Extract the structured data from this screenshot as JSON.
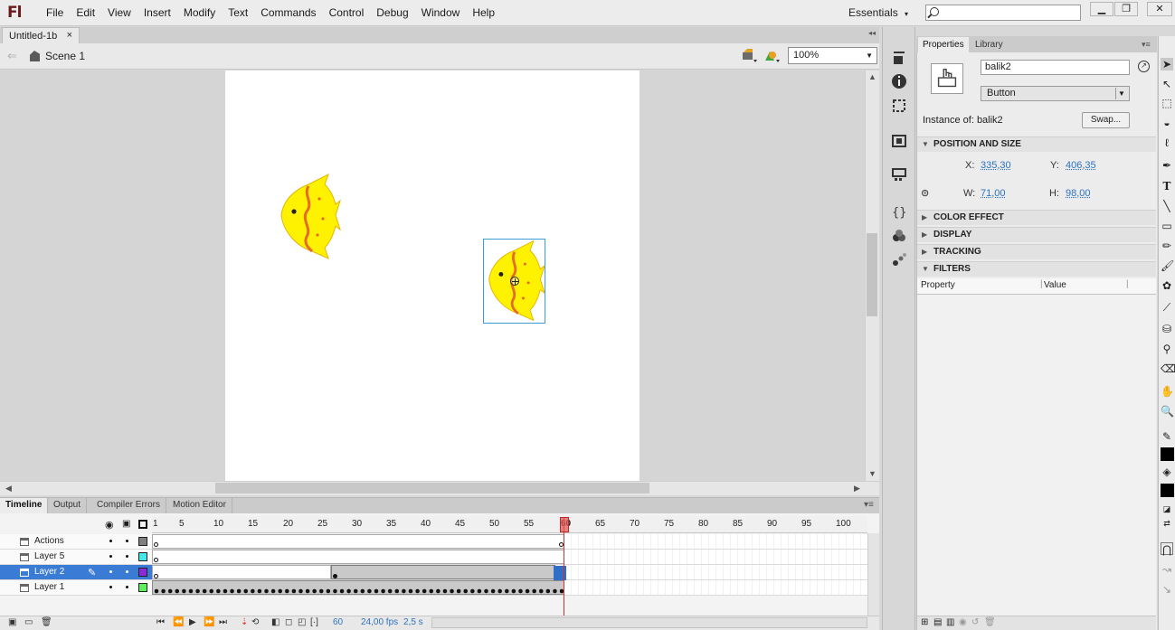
{
  "app": {
    "logo": "Fl",
    "menu": [
      "File",
      "Edit",
      "View",
      "Insert",
      "Modify",
      "Text",
      "Commands",
      "Control",
      "Debug",
      "Window",
      "Help"
    ],
    "workspace": "Essentials",
    "search_placeholder": ""
  },
  "document": {
    "tab_title": "Untitled-1b",
    "tab_close": "×",
    "scene": "Scene 1",
    "zoom": "100%"
  },
  "colors": {
    "selection": "#3f9bd6",
    "selected_layer": "#3a7bd5",
    "playhead": "#e02a2a",
    "fish_body": "#fff200",
    "fish_stripe": "#e8712a"
  },
  "timeline": {
    "tabs": [
      "Timeline",
      "Output",
      "Compiler Errors",
      "Motion Editor"
    ],
    "ruler": [
      "1",
      "5",
      "10",
      "15",
      "20",
      "25",
      "30",
      "35",
      "40",
      "45",
      "50",
      "55",
      "60",
      "65",
      "70",
      "75",
      "80",
      "85",
      "90",
      "95",
      "100"
    ],
    "layers": [
      {
        "name": "Actions",
        "color": "#7f7f7f",
        "selected": false
      },
      {
        "name": "Layer 5",
        "color": "#44e8e8",
        "selected": false
      },
      {
        "name": "Layer 2",
        "color": "#8a2bd6",
        "selected": true
      },
      {
        "name": "Layer 1",
        "color": "#5cf05c",
        "selected": false
      }
    ],
    "current_frame": "60",
    "fps": "24,00 fps",
    "time": "2,5 s"
  },
  "properties": {
    "tabs": [
      "Properties",
      "Library"
    ],
    "instance_name": "balik2",
    "symbol_type": "Button",
    "instance_of_label": "Instance of:",
    "instance_of": "balik2",
    "swap": "Swap...",
    "sections": {
      "position": "POSITION AND SIZE",
      "color_effect": "COLOR EFFECT",
      "display": "DISPLAY",
      "tracking": "TRACKING",
      "filters": "FILTERS"
    },
    "x_label": "X:",
    "x": "335,30",
    "y_label": "Y:",
    "y": "406,35",
    "w_label": "W:",
    "w": "71,00",
    "h_label": "H:",
    "h": "98,00",
    "filter_columns": [
      "Property",
      "Value"
    ]
  }
}
